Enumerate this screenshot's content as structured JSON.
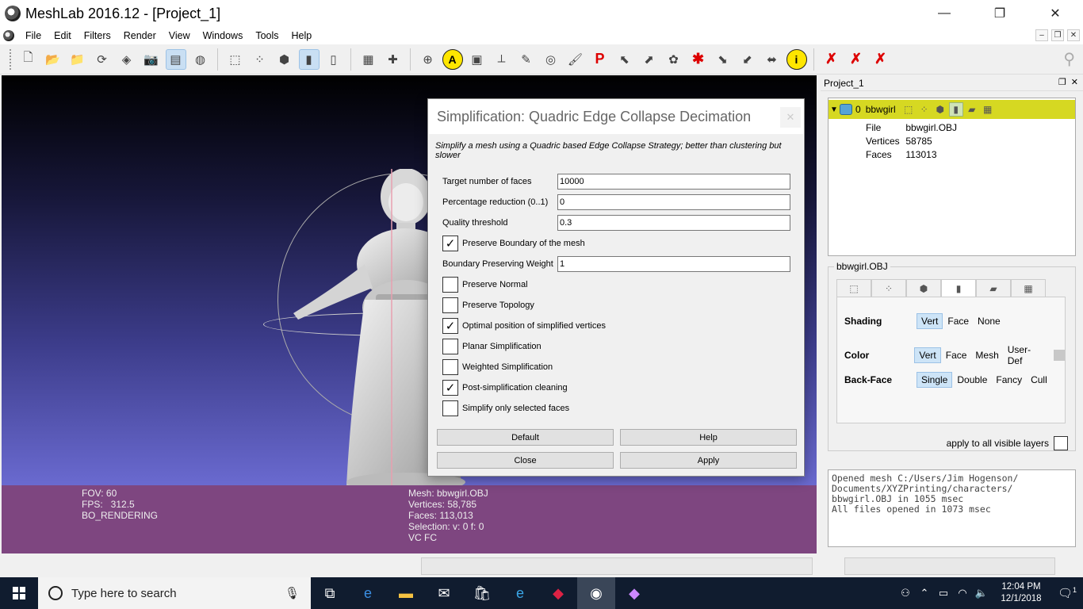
{
  "window": {
    "title": "MeshLab 2016.12 - [Project_1]",
    "minimize": "—",
    "maximize": "❐",
    "close": "✕"
  },
  "menu": {
    "items": [
      "File",
      "Edit",
      "Filters",
      "Render",
      "View",
      "Windows",
      "Tools",
      "Help"
    ],
    "mdi": [
      "–",
      "❐",
      "✕"
    ]
  },
  "viewport": {
    "fov": "FOV: 60",
    "fps": "FPS:   312.5",
    "rendering": "BO_RENDERING",
    "mesh": "Mesh: bbwgirl.OBJ",
    "vertices": "Vertices: 58,785",
    "faces": "Faces: 113,013",
    "selection": "Selection: v: 0 f: 0",
    "attrs": "VC FC"
  },
  "dialog": {
    "title": "Simplification: Quadric Edge Collapse Decimation",
    "close": "✕",
    "description": "Simplify a mesh using a Quadric based Edge Collapse Strategy; better than clustering but slower",
    "fields": {
      "target_faces": {
        "label": "Target number of faces",
        "value": "10000"
      },
      "percentage": {
        "label": "Percentage reduction (0..1)",
        "value": "0"
      },
      "quality": {
        "label": "Quality threshold",
        "value": "0.3"
      },
      "boundary_weight": {
        "label": "Boundary Preserving Weight",
        "value": "1"
      }
    },
    "checks": {
      "preserve_boundary": {
        "label": "Preserve Boundary of the mesh",
        "mark": "✓"
      },
      "preserve_normal": {
        "label": "Preserve Normal",
        "mark": ""
      },
      "preserve_topology": {
        "label": "Preserve Topology",
        "mark": ""
      },
      "optimal_position": {
        "label": "Optimal position of simplified vertices",
        "mark": "✓"
      },
      "planar": {
        "label": "Planar Simplification",
        "mark": ""
      },
      "weighted": {
        "label": "Weighted Simplification",
        "mark": ""
      },
      "post_cleaning": {
        "label": "Post-simplification cleaning",
        "mark": "✓"
      },
      "selected_only": {
        "label": "Simplify only selected faces",
        "mark": ""
      }
    },
    "buttons": {
      "default": "Default",
      "help": "Help",
      "close": "Close",
      "apply": "Apply"
    }
  },
  "panel": {
    "title": "Project_1",
    "header_btns": [
      "❐",
      "✕"
    ],
    "layer": {
      "arrow": "▼",
      "id": "0",
      "name": "bbwgirl",
      "file_key": "File",
      "file_val": "bbwgirl.OBJ",
      "verts_key": "Vertices",
      "verts_val": "58785",
      "faces_key": "Faces",
      "faces_val": "113013"
    },
    "group_title": "bbwgirl.OBJ",
    "shading": {
      "label": "Shading",
      "options": [
        "Vert",
        "Face",
        "None"
      ]
    },
    "color": {
      "label": "Color",
      "options": [
        "Vert",
        "Face",
        "Mesh",
        "User-Def"
      ]
    },
    "backface": {
      "label": "Back-Face",
      "options": [
        "Single",
        "Double",
        "Fancy",
        "Cull"
      ]
    },
    "apply_all": "apply to all visible layers"
  },
  "log": "Opened mesh C:/Users/Jim Hogenson/\nDocuments/XYZPrinting/characters/\nbbwgirl.OBJ in 1055 msec\nAll files opened in 1073 msec",
  "taskbar": {
    "search_placeholder": "Type here to search",
    "time": "12:04 PM",
    "date": "12/1/2018",
    "notif_count": "1"
  }
}
